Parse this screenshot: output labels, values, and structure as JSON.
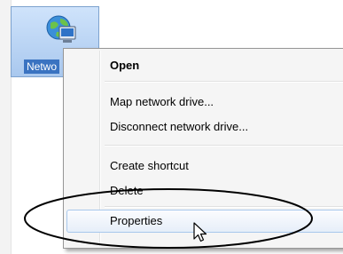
{
  "desktop": {
    "icon_label": "Netwo",
    "icon_name": "network-icon"
  },
  "context_menu": {
    "items": [
      {
        "label": "Open",
        "bold": true
      },
      {
        "label": "Map network drive..."
      },
      {
        "label": "Disconnect network drive..."
      },
      {
        "label": "Create shortcut"
      },
      {
        "label": "Delete"
      },
      {
        "label": "Properties",
        "highlighted": true
      }
    ]
  },
  "colors": {
    "selection_fill": "#a9c8ee",
    "menu_background": "#f5f5f5",
    "highlight_border": "#a8c8ec",
    "annotation_stroke": "#000000"
  }
}
